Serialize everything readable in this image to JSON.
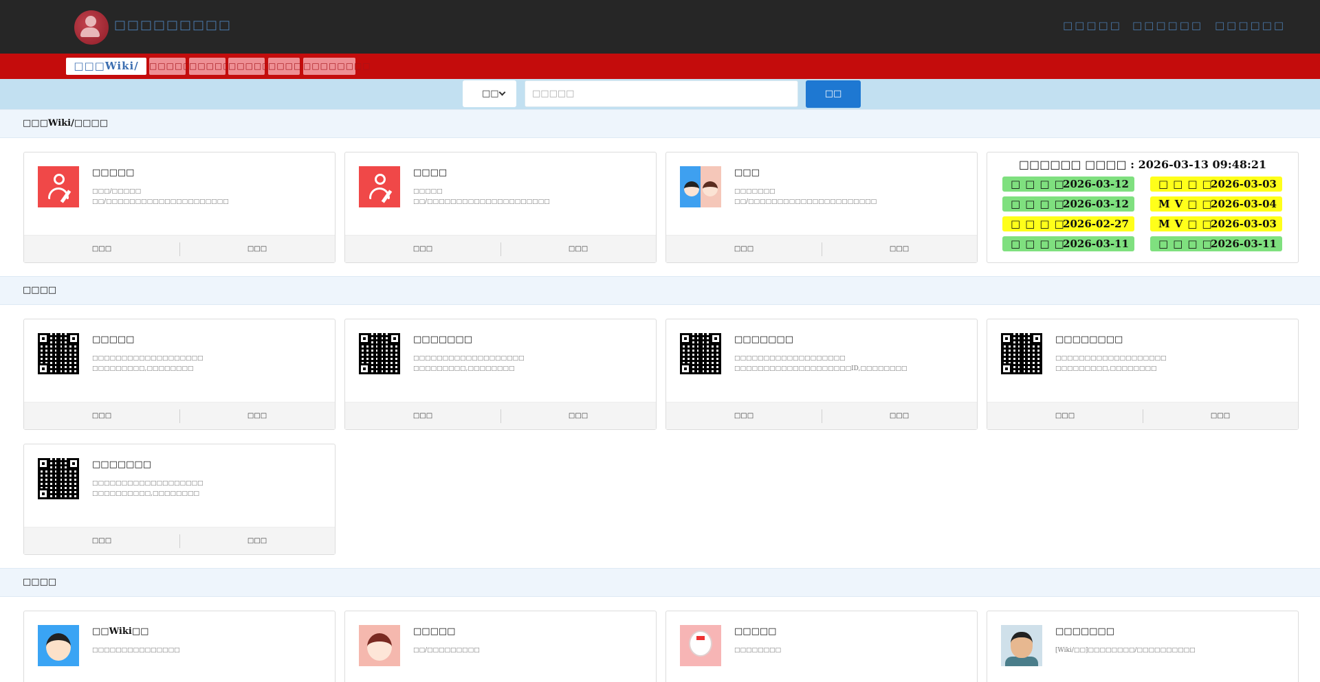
{
  "header": {
    "site_title": "□□□□□□□□□",
    "nav": [
      "□□□□□",
      "□□□□□□",
      "□□□□□□"
    ]
  },
  "tabs": [
    "□□□Wiki/□□□□",
    "□□□□□",
    "□□□□□",
    "□□□□□",
    "□□□□",
    "□□□□□□□□"
  ],
  "search": {
    "select_value": "□□",
    "placeholder": "□□□□□",
    "button_label": "□□"
  },
  "sections": [
    {
      "title": "□□□Wiki/□□□□",
      "cards": [
        {
          "title": "□□□□□",
          "desc": [
            "□□□/□□□□□",
            "□□/□□□□□□□□□□□□□□□□□□□□□"
          ],
          "left": "□□□",
          "right": "□□□"
        },
        {
          "title": "□□□□",
          "desc": [
            "□□□□□",
            "□□/□□□□□□□□□□□□□□□□□□□□□"
          ],
          "left": "□□□",
          "right": "□□□"
        },
        {
          "title": "□□□",
          "desc": [
            "□□□□□□□",
            "□□/□□□□□□□□□□□□□□□□□□□□□□"
          ],
          "left": "□□□",
          "right": "□□□"
        }
      ]
    },
    {
      "title": "□□□□",
      "cards": [
        {
          "title": "□□□□□",
          "desc": [
            "□□□□□□□□□□□□□□□□□□□",
            "□□□□□□□□□,□□□□□□□□"
          ],
          "left": "□□□",
          "right": "□□□"
        },
        {
          "title": "□□□□□□□",
          "desc": [
            "□□□□□□□□□□□□□□□□□□□",
            "□□□□□□□□□,□□□□□□□□"
          ],
          "left": "□□□",
          "right": "□□□"
        },
        {
          "title": "□□□□□□□",
          "desc": [
            "□□□□□□□□□□□□□□□□□□□",
            "□□□□□□□□□□□□□□□□□□□□ID,□□□□□□□□"
          ],
          "left": "□□□",
          "right": "□□□"
        },
        {
          "title": "□□□□□□□□",
          "desc": [
            "□□□□□□□□□□□□□□□□□□□",
            "□□□□□□□□□,□□□□□□□□"
          ],
          "left": "□□□",
          "right": "□□□"
        },
        {
          "title": "□□□□□□□",
          "desc": [
            "□□□□□□□□□□□□□□□□□□□",
            "□□□□□□□□□□,□□□□□□□□"
          ],
          "left": "□□□",
          "right": "□□□"
        }
      ]
    },
    {
      "title": "□□□□",
      "cards": [
        {
          "title": "□□Wiki□□",
          "desc": [
            "□□□□□□□□□□□□□□□"
          ]
        },
        {
          "title": "□□□□□",
          "desc": [
            "□□/□□□□□□□□□"
          ]
        },
        {
          "title": "□□□□□",
          "desc": [
            "□□□□□□□□"
          ]
        },
        {
          "title": "□□□□□□□",
          "desc": [
            "[Wiki/□□]□□□□□□□□/□□□□□□□□□□"
          ]
        }
      ]
    }
  ],
  "timestamps": {
    "title": "□□□□□□ □□□□ : 2026-03-13 09:48:21",
    "items": [
      {
        "label": "□□□□",
        "date": "2026-03-12",
        "color": "#7fe07f"
      },
      {
        "label": "□□□□",
        "date": "2026-03-03",
        "color": "#ffff1a"
      },
      {
        "label": "□□□□",
        "date": "2026-03-12",
        "color": "#7fe07f"
      },
      {
        "label": "MV□□",
        "date": "2026-03-04",
        "color": "#ffff1a"
      },
      {
        "label": "□□□□",
        "date": "2026-02-27",
        "color": "#ffff1a"
      },
      {
        "label": "MV□□",
        "date": "2026-03-03",
        "color": "#ffff1a"
      },
      {
        "label": "□□□□",
        "date": "2026-03-11",
        "color": "#7fe07f"
      },
      {
        "label": "□□□□",
        "date": "2026-03-11",
        "color": "#7fe07f"
      }
    ]
  },
  "colors": {
    "topbar": "#262626",
    "rednav": "#c40c0c",
    "searchband": "#c2e0f1",
    "accent": "#1e78d2"
  }
}
